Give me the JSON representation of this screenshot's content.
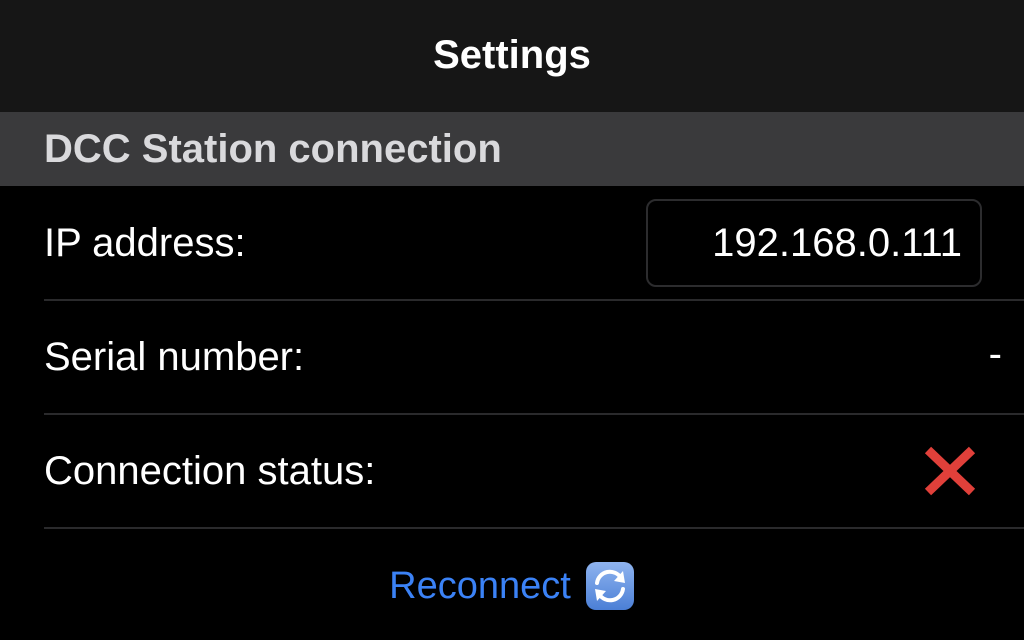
{
  "nav": {
    "title": "Settings"
  },
  "section": {
    "title": "DCC Station connection"
  },
  "rows": {
    "ip": {
      "label": "IP address:",
      "value": "192.168.0.111"
    },
    "serial": {
      "label": "Serial number:",
      "value": "-"
    },
    "status": {
      "label": "Connection status:",
      "icon": "cross-mark-icon",
      "icon_color": "#e0403a"
    }
  },
  "reconnect": {
    "label": "Reconnect",
    "icon": "refresh-icon"
  },
  "colors": {
    "accent": "#3b82f6",
    "error": "#e0403a",
    "section_bg": "#3a3a3c",
    "nav_bg": "#161616"
  }
}
